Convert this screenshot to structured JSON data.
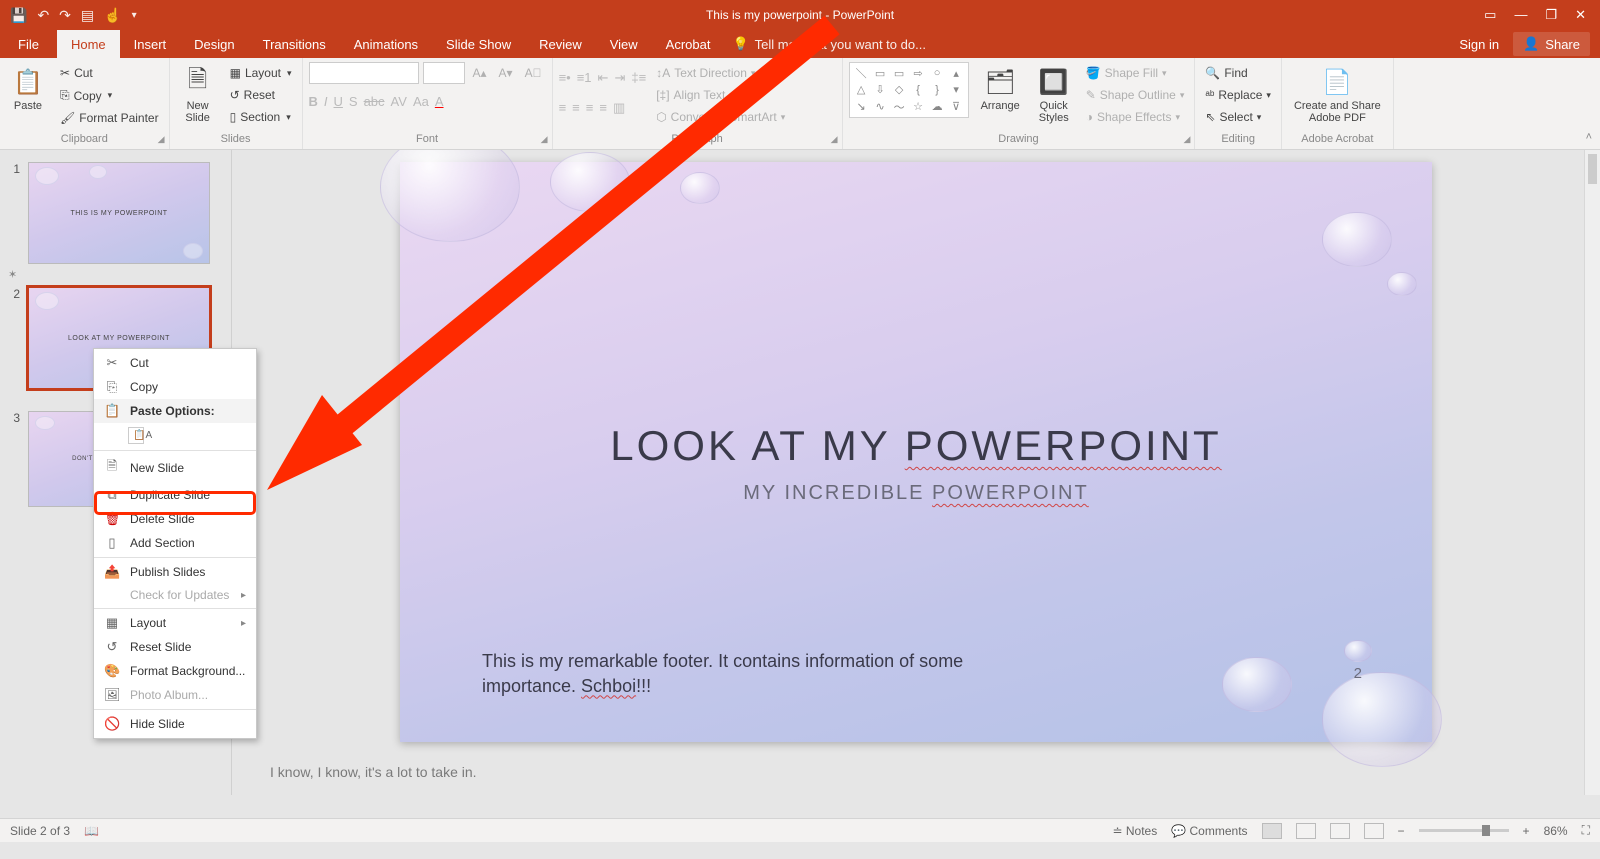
{
  "titlebar": {
    "title": "This is my powerpoint - PowerPoint"
  },
  "tabs": {
    "file": "File",
    "home": "Home",
    "insert": "Insert",
    "design": "Design",
    "transitions": "Transitions",
    "animations": "Animations",
    "slideshow": "Slide Show",
    "review": "Review",
    "view": "View",
    "acrobat": "Acrobat",
    "tellme": "Tell me what you want to do...",
    "signin": "Sign in",
    "share": "Share"
  },
  "ribbon": {
    "clipboard": {
      "label": "Clipboard",
      "paste": "Paste",
      "cut": "Cut",
      "copy": "Copy",
      "format_painter": "Format Painter"
    },
    "slides": {
      "label": "Slides",
      "new_slide": "New\nSlide",
      "layout": "Layout",
      "reset": "Reset",
      "section": "Section"
    },
    "font": {
      "label": "Font"
    },
    "paragraph": {
      "label": "Paragraph",
      "text_direction": "Text Direction",
      "align_text": "Align Text",
      "smartart": "Convert to SmartArt"
    },
    "drawing": {
      "label": "Drawing",
      "arrange": "Arrange",
      "quick_styles": "Quick\nStyles",
      "shape_fill": "Shape Fill",
      "shape_outline": "Shape Outline",
      "shape_effects": "Shape Effects"
    },
    "editing": {
      "label": "Editing",
      "find": "Find",
      "replace": "Replace",
      "select": "Select"
    },
    "adobe": {
      "label": "Adobe Acrobat",
      "create_share": "Create and Share\nAdobe PDF"
    }
  },
  "thumbnails": {
    "n1": "1",
    "n2": "2",
    "n3": "3",
    "t1": "THIS IS MY POWERPOINT",
    "t2": "LOOK AT MY POWERPOINT",
    "t3": "DON'T BE TOO INTIMIDATED"
  },
  "context_menu": {
    "cut": "Cut",
    "copy": "Copy",
    "paste_hdr": "Paste Options:",
    "new_slide": "New Slide",
    "duplicate": "Duplicate Slide",
    "delete": "Delete Slide",
    "add_section": "Add Section",
    "publish": "Publish Slides",
    "check_updates": "Check for Updates",
    "layout": "Layout",
    "reset": "Reset Slide",
    "format_bg": "Format Background...",
    "photo_album": "Photo Album...",
    "hide": "Hide Slide"
  },
  "slide": {
    "title_pre": "LOOK AT MY ",
    "title_wavy": "POWERPOINT",
    "sub_pre": "MY INCREDIBLE ",
    "sub_wavy": "POWERPOINT",
    "footer_pre": "This is my remarkable footer. It contains information of some importance. ",
    "footer_wavy": "Schboi",
    "footer_post": "!!!",
    "page_num": "2"
  },
  "notes": {
    "text": "I know, I know, it's a lot to take in."
  },
  "statusbar": {
    "slide_of": "Slide 2 of 3",
    "notes": "Notes",
    "comments": "Comments",
    "zoom_pct": "86%"
  }
}
